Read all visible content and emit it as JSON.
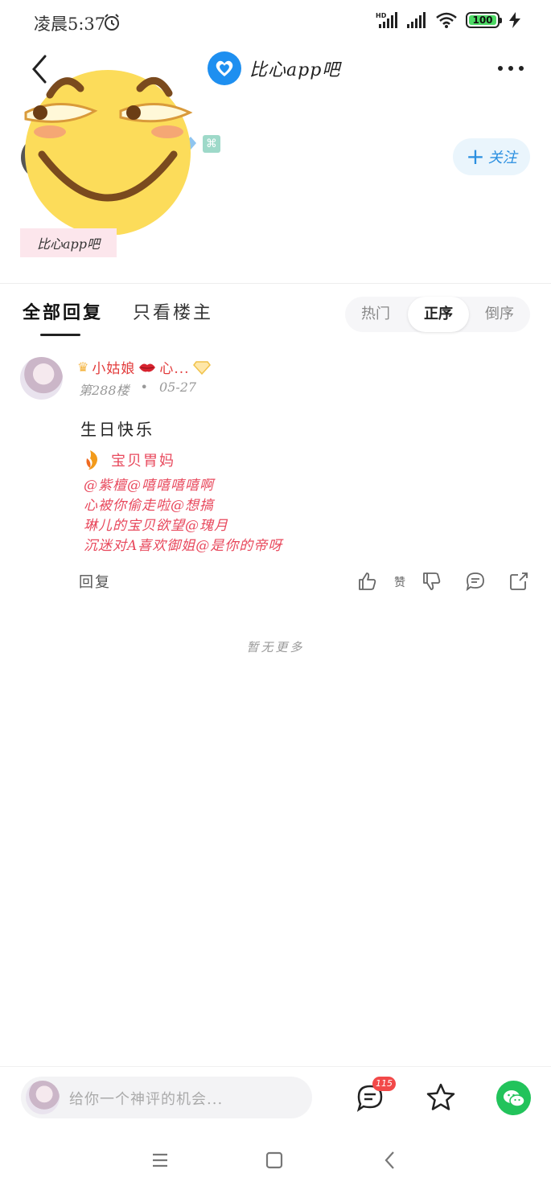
{
  "status_bar": {
    "time": "凌晨5:37",
    "battery_level": "100"
  },
  "nav": {
    "forum_name": "比心app吧"
  },
  "author": {
    "follow_label": "关注",
    "forum_tag": "比心app吧"
  },
  "tabs": {
    "all_replies": "全部回复",
    "owner_only": "只看楼主",
    "sort_hot": "热门",
    "sort_asc": "正序",
    "sort_desc": "倒序"
  },
  "reply": {
    "username": "小姑娘",
    "username_suffix": "心...",
    "floor": "第288楼",
    "dot": "•",
    "date": "05-27",
    "content": "生日快乐",
    "tail_title": "宝贝胃妈",
    "tail_lines": [
      "@紫檀@嘻嘻嘻嘻啊",
      "心被你偷走啦@想搞",
      "琳儿的宝贝欲望@瑰月",
      "沉迷对A喜欢御姐@是你的帝呀"
    ],
    "reply_label": "回复",
    "like_label": "赞"
  },
  "footer": {
    "no_more": "暂无更多"
  },
  "bottom_bar": {
    "input_placeholder": "给你一个神评的机会...",
    "comment_count": "115"
  },
  "colors": {
    "accent_blue": "#2a8fe0",
    "name_red": "#e23b3b",
    "tail_pink": "#e8485c",
    "wechat_green": "#22c35b",
    "badge_red": "#f24949"
  }
}
